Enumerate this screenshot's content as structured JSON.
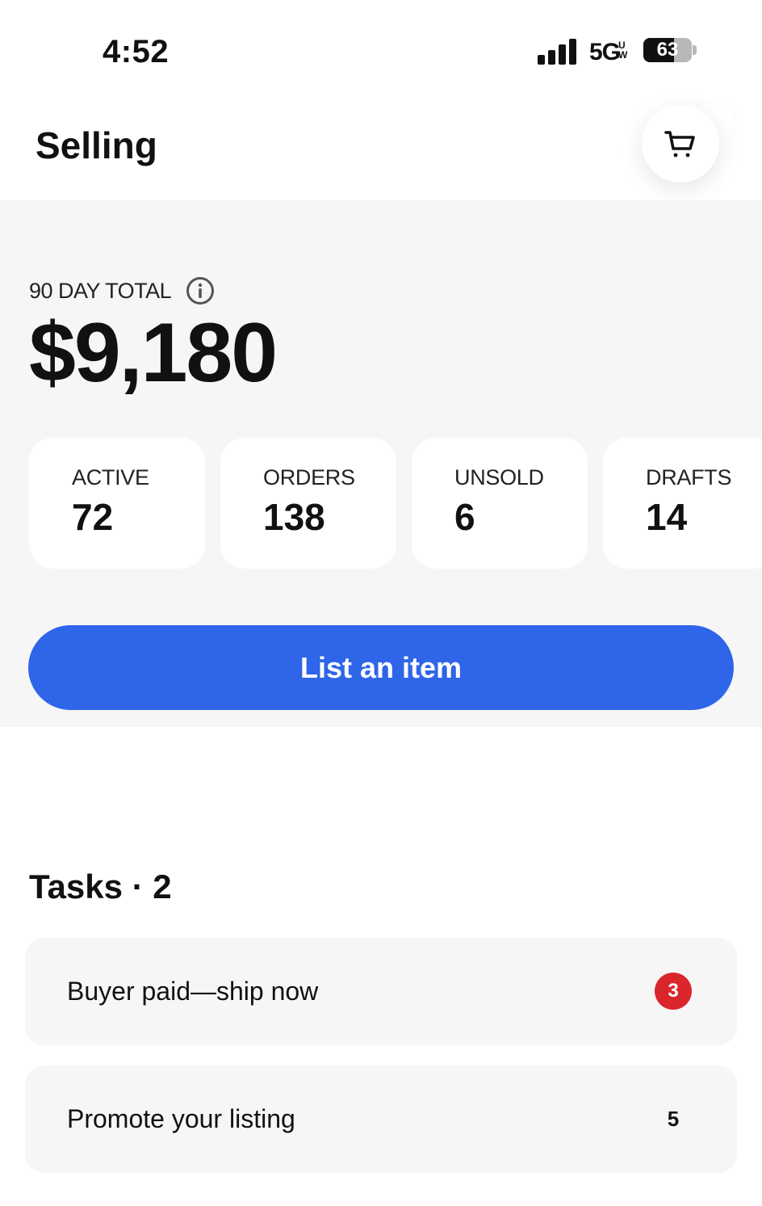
{
  "status_bar": {
    "time": "4:52",
    "network": "5G",
    "network_sup": "UW",
    "battery_percent": "63",
    "battery_level": 0.63
  },
  "header": {
    "title": "Selling",
    "cart_icon": "shopping-cart-icon"
  },
  "summary": {
    "total_label": "90 DAY TOTAL",
    "info_icon": "info-icon",
    "total_amount": "$9,180",
    "stats": [
      {
        "label": "ACTIVE",
        "value": "72"
      },
      {
        "label": "ORDERS",
        "value": "138"
      },
      {
        "label": "UNSOLD",
        "value": "6"
      },
      {
        "label": "DRAFTS",
        "value": "14"
      }
    ],
    "list_button_label": "List an item"
  },
  "tasks": {
    "title": "Tasks · 2",
    "items": [
      {
        "label": "Buyer paid—ship now",
        "count": "3"
      },
      {
        "label": "Promote your listing",
        "count": "5"
      }
    ]
  },
  "colors": {
    "accent": "#2f65e8",
    "badge": "#d9262c",
    "panel": "#f6f6f6"
  }
}
